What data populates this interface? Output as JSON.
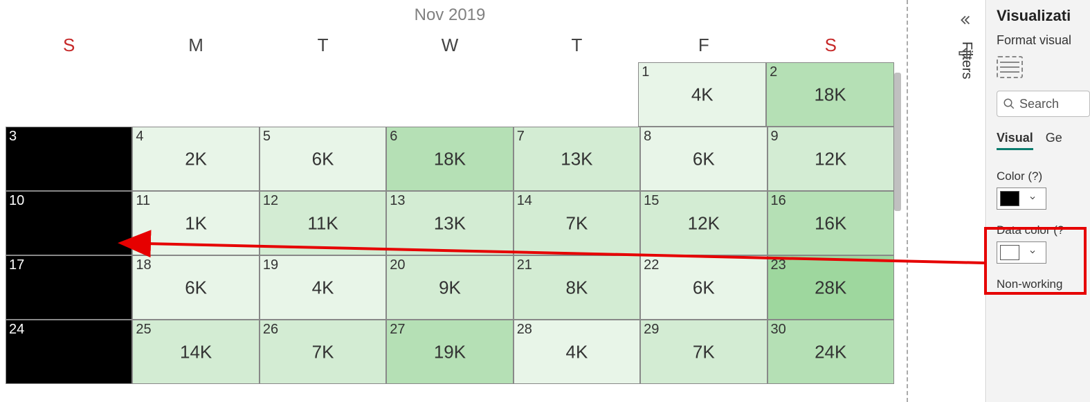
{
  "month_title": "Nov 2019",
  "day_headers": [
    "S",
    "M",
    "T",
    "W",
    "T",
    "F",
    "S"
  ],
  "weeks": [
    [
      {
        "blank": true
      },
      {
        "blank": true
      },
      {
        "blank": true
      },
      {
        "blank": true
      },
      {
        "blank": true
      },
      {
        "day": "1",
        "value": "4K",
        "shade": "shade1"
      },
      {
        "day": "2",
        "value": "18K",
        "shade": "shade3"
      }
    ],
    [
      {
        "day": "3",
        "black": true
      },
      {
        "day": "4",
        "value": "2K",
        "shade": "shade1"
      },
      {
        "day": "5",
        "value": "6K",
        "shade": "shade1"
      },
      {
        "day": "6",
        "value": "18K",
        "shade": "shade3"
      },
      {
        "day": "7",
        "value": "13K",
        "shade": "shade2"
      },
      {
        "day": "8",
        "value": "6K",
        "shade": "shade1"
      },
      {
        "day": "9",
        "value": "12K",
        "shade": "shade2"
      }
    ],
    [
      {
        "day": "10",
        "black": true
      },
      {
        "day": "11",
        "value": "1K",
        "shade": "shade1"
      },
      {
        "day": "12",
        "value": "11K",
        "shade": "shade2"
      },
      {
        "day": "13",
        "value": "13K",
        "shade": "shade2"
      },
      {
        "day": "14",
        "value": "7K",
        "shade": "shade2"
      },
      {
        "day": "15",
        "value": "12K",
        "shade": "shade2"
      },
      {
        "day": "16",
        "value": "16K",
        "shade": "shade3"
      }
    ],
    [
      {
        "day": "17",
        "black": true
      },
      {
        "day": "18",
        "value": "6K",
        "shade": "shade1"
      },
      {
        "day": "19",
        "value": "4K",
        "shade": "shade1"
      },
      {
        "day": "20",
        "value": "9K",
        "shade": "shade2"
      },
      {
        "day": "21",
        "value": "8K",
        "shade": "shade2"
      },
      {
        "day": "22",
        "value": "6K",
        "shade": "shade1"
      },
      {
        "day": "23",
        "value": "28K",
        "shade": "shade4"
      }
    ],
    [
      {
        "day": "24",
        "black": true
      },
      {
        "day": "25",
        "value": "14K",
        "shade": "shade2"
      },
      {
        "day": "26",
        "value": "7K",
        "shade": "shade2"
      },
      {
        "day": "27",
        "value": "19K",
        "shade": "shade3"
      },
      {
        "day": "28",
        "value": "4K",
        "shade": "shade1"
      },
      {
        "day": "29",
        "value": "7K",
        "shade": "shade2"
      },
      {
        "day": "30",
        "value": "24K",
        "shade": "shade3"
      }
    ]
  ],
  "filters_label": "Filters",
  "viz": {
    "title": "Visualizati",
    "subtitle": "Format visual",
    "search_placeholder": "Search",
    "tabs": {
      "visual": "Visual",
      "general": "Ge"
    },
    "color_label": "Color (?)",
    "color_swatch": "#000000",
    "data_color_label": "Data color (?",
    "data_color_swatch": "#ffffff",
    "nonworking_label": "Non-working"
  },
  "chart_data": {
    "type": "heatmap",
    "title": "Nov 2019",
    "columns": [
      "S",
      "M",
      "T",
      "W",
      "T",
      "F",
      "S"
    ],
    "cells": [
      {
        "date": "2019-11-01",
        "day": 1,
        "weekday": "F",
        "value_label": "4K",
        "value": 4000
      },
      {
        "date": "2019-11-02",
        "day": 2,
        "weekday": "S",
        "value_label": "18K",
        "value": 18000
      },
      {
        "date": "2019-11-03",
        "day": 3,
        "weekday": "S",
        "value_label": null,
        "value": null,
        "nonworking": true
      },
      {
        "date": "2019-11-04",
        "day": 4,
        "weekday": "M",
        "value_label": "2K",
        "value": 2000
      },
      {
        "date": "2019-11-05",
        "day": 5,
        "weekday": "T",
        "value_label": "6K",
        "value": 6000
      },
      {
        "date": "2019-11-06",
        "day": 6,
        "weekday": "W",
        "value_label": "18K",
        "value": 18000
      },
      {
        "date": "2019-11-07",
        "day": 7,
        "weekday": "T",
        "value_label": "13K",
        "value": 13000
      },
      {
        "date": "2019-11-08",
        "day": 8,
        "weekday": "F",
        "value_label": "6K",
        "value": 6000
      },
      {
        "date": "2019-11-09",
        "day": 9,
        "weekday": "S",
        "value_label": "12K",
        "value": 12000
      },
      {
        "date": "2019-11-10",
        "day": 10,
        "weekday": "S",
        "value_label": null,
        "value": null,
        "nonworking": true
      },
      {
        "date": "2019-11-11",
        "day": 11,
        "weekday": "M",
        "value_label": "1K",
        "value": 1000
      },
      {
        "date": "2019-11-12",
        "day": 12,
        "weekday": "T",
        "value_label": "11K",
        "value": 11000
      },
      {
        "date": "2019-11-13",
        "day": 13,
        "weekday": "W",
        "value_label": "13K",
        "value": 13000
      },
      {
        "date": "2019-11-14",
        "day": 14,
        "weekday": "T",
        "value_label": "7K",
        "value": 7000
      },
      {
        "date": "2019-11-15",
        "day": 15,
        "weekday": "F",
        "value_label": "12K",
        "value": 12000
      },
      {
        "date": "2019-11-16",
        "day": 16,
        "weekday": "S",
        "value_label": "16K",
        "value": 16000
      },
      {
        "date": "2019-11-17",
        "day": 17,
        "weekday": "S",
        "value_label": null,
        "value": null,
        "nonworking": true
      },
      {
        "date": "2019-11-18",
        "day": 18,
        "weekday": "M",
        "value_label": "6K",
        "value": 6000
      },
      {
        "date": "2019-11-19",
        "day": 19,
        "weekday": "T",
        "value_label": "4K",
        "value": 4000
      },
      {
        "date": "2019-11-20",
        "day": 20,
        "weekday": "W",
        "value_label": "9K",
        "value": 9000
      },
      {
        "date": "2019-11-21",
        "day": 21,
        "weekday": "T",
        "value_label": "8K",
        "value": 8000
      },
      {
        "date": "2019-11-22",
        "day": 22,
        "weekday": "F",
        "value_label": "6K",
        "value": 6000
      },
      {
        "date": "2019-11-23",
        "day": 23,
        "weekday": "S",
        "value_label": "28K",
        "value": 28000
      },
      {
        "date": "2019-11-24",
        "day": 24,
        "weekday": "S",
        "value_label": null,
        "value": null,
        "nonworking": true
      },
      {
        "date": "2019-11-25",
        "day": 25,
        "weekday": "M",
        "value_label": "14K",
        "value": 14000
      },
      {
        "date": "2019-11-26",
        "day": 26,
        "weekday": "T",
        "value_label": "7K",
        "value": 7000
      },
      {
        "date": "2019-11-27",
        "day": 27,
        "weekday": "W",
        "value_label": "19K",
        "value": 19000
      },
      {
        "date": "2019-11-28",
        "day": 28,
        "weekday": "T",
        "value_label": "4K",
        "value": 4000
      },
      {
        "date": "2019-11-29",
        "day": 29,
        "weekday": "F",
        "value_label": "7K",
        "value": 7000
      },
      {
        "date": "2019-11-30",
        "day": 30,
        "weekday": "S",
        "value_label": "24K",
        "value": 24000
      }
    ]
  }
}
